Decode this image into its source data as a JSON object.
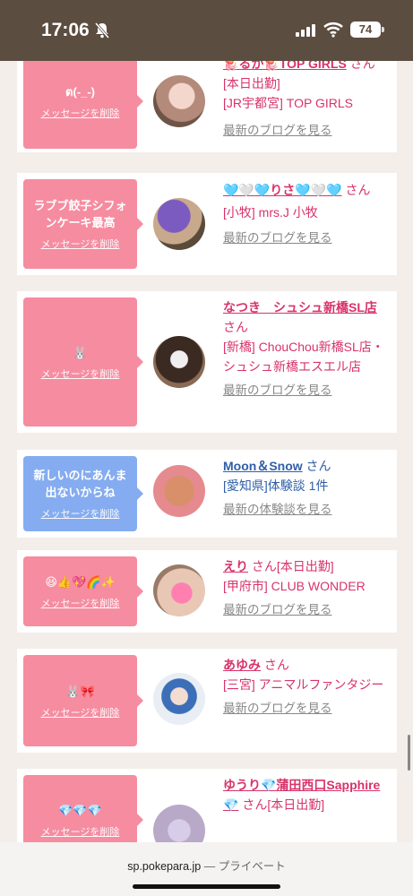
{
  "status": {
    "time": "17:06",
    "battery": "74"
  },
  "browser": {
    "url": "sp.pokepara.jp",
    "mode": "— プライベート"
  },
  "cards": [
    {
      "message": "ต(-_-)",
      "delete": "メッセージを削除",
      "name": "🪼るか🪼TOP GIRLS",
      "suffix": "さん[本日出勤]",
      "detail": "[JR宇都宮] TOP GIRLS",
      "link": "最新のブログを見る"
    },
    {
      "message": "ラブブ餃子シフォンケーキ最高",
      "delete": "メッセージを削除",
      "name": "🩵🤍🩵りさ🩵🤍🩵",
      "suffix": "さん",
      "detail": "[小牧] mrs.J 小牧",
      "link": "最新のブログを見る"
    },
    {
      "message": "🐰",
      "delete": "メッセージを削除",
      "name": "なつき　シュシュ新橋SL店",
      "suffix": "さん",
      "detail": "[新橋] ChouChou新橋SL店・シュシュ新橋エスエル店",
      "link": "最新のブログを見る"
    },
    {
      "message": "新しいのにあんま出ないからね",
      "delete": "メッセージを削除",
      "name": "Moon＆Snow",
      "suffix": "さん",
      "detail": "[愛知県]体験談 1件",
      "link": "最新の体験談を見る"
    },
    {
      "message": "😆👍💖🌈✨",
      "delete": "メッセージを削除",
      "name": "えり",
      "suffix": "さん[本日出勤]",
      "detail": "[甲府市] CLUB WONDER",
      "link": "最新のブログを見る"
    },
    {
      "message": "🐰🎀",
      "delete": "メッセージを削除",
      "name": "あゆみ",
      "suffix": "さん",
      "detail": "[三宮] アニマルファンタジー",
      "link": "最新のブログを見る"
    },
    {
      "message": "💎💎💎",
      "delete": "メッセージを削除",
      "name": "ゆうり💎蒲田西口Sapphire💎",
      "suffix": "さん[本日出勤]",
      "detail": "",
      "link": ""
    }
  ]
}
